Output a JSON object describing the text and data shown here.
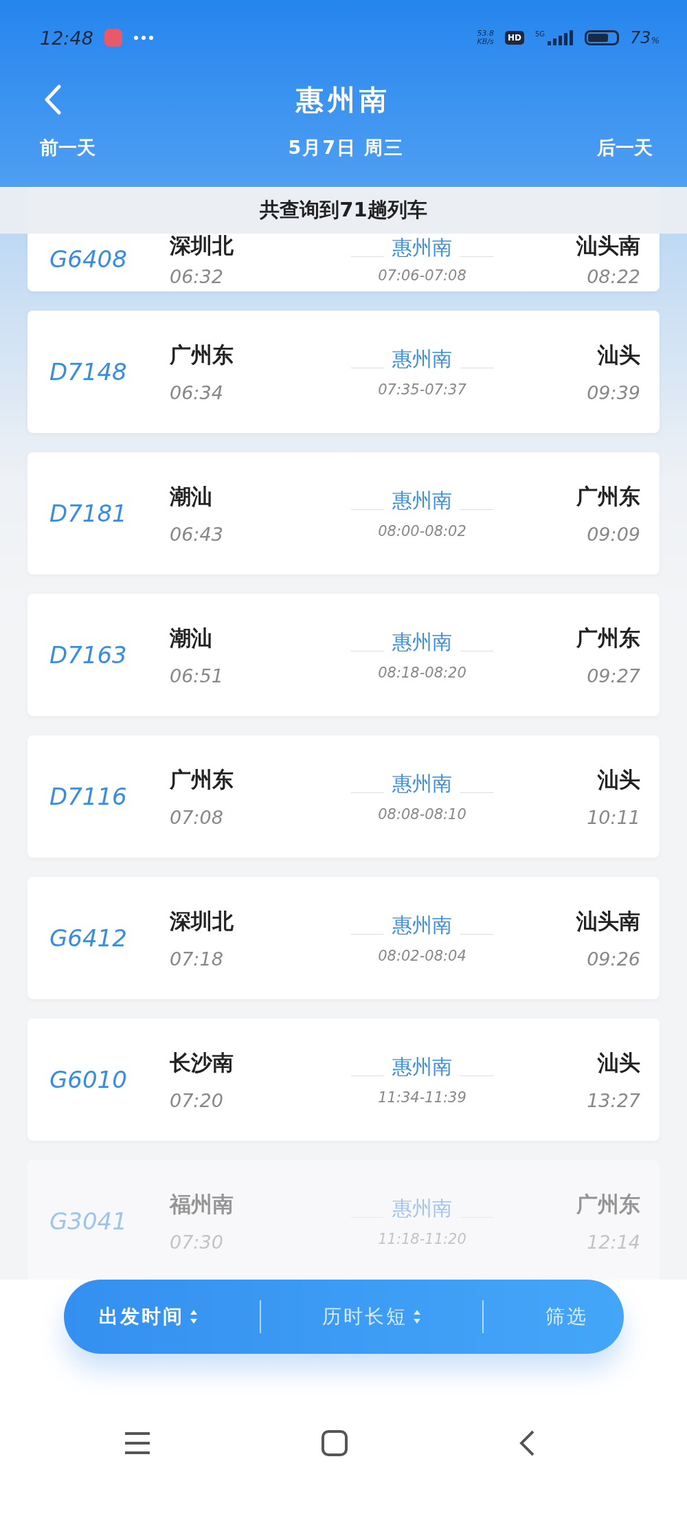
{
  "status_bar": {
    "time": "12:48",
    "speed_value": "53.8",
    "speed_unit": "KB/s",
    "hd": "HD",
    "network": "5G",
    "battery_text": "73",
    "battery_unit": "%"
  },
  "header": {
    "title": "惠州南",
    "prev_day": "前一天",
    "date": "5月7日 周三",
    "next_day": "后一天"
  },
  "result_banner": "共查询到71趟列车",
  "trains": [
    {
      "number": "G6408",
      "from": "深圳北",
      "depart": "06:32",
      "station": "惠州南",
      "stop": "07:06-07:08",
      "to": "汕头南",
      "arrive": "08:22",
      "faded": false
    },
    {
      "number": "D7148",
      "from": "广州东",
      "depart": "06:34",
      "station": "惠州南",
      "stop": "07:35-07:37",
      "to": "汕头",
      "arrive": "09:39",
      "faded": false
    },
    {
      "number": "D7181",
      "from": "潮汕",
      "depart": "06:43",
      "station": "惠州南",
      "stop": "08:00-08:02",
      "to": "广州东",
      "arrive": "09:09",
      "faded": false
    },
    {
      "number": "D7163",
      "from": "潮汕",
      "depart": "06:51",
      "station": "惠州南",
      "stop": "08:18-08:20",
      "to": "广州东",
      "arrive": "09:27",
      "faded": false
    },
    {
      "number": "D7116",
      "from": "广州东",
      "depart": "07:08",
      "station": "惠州南",
      "stop": "08:08-08:10",
      "to": "汕头",
      "arrive": "10:11",
      "faded": false
    },
    {
      "number": "G6412",
      "from": "深圳北",
      "depart": "07:18",
      "station": "惠州南",
      "stop": "08:02-08:04",
      "to": "汕头南",
      "arrive": "09:26",
      "faded": false
    },
    {
      "number": "G6010",
      "from": "长沙南",
      "depart": "07:20",
      "station": "惠州南",
      "stop": "11:34-11:39",
      "to": "汕头",
      "arrive": "13:27",
      "faded": false
    },
    {
      "number": "G3041",
      "from": "福州南",
      "depart": "07:30",
      "station": "惠州南",
      "stop": "11:18-11:20",
      "to": "广州东",
      "arrive": "12:14",
      "faded": true
    }
  ],
  "sort_bar": [
    {
      "label": "出发时间",
      "kind": "sort",
      "selected": true
    },
    {
      "label": "历时长短",
      "kind": "sort",
      "selected": false
    },
    {
      "label": "筛选",
      "kind": "filter",
      "selected": false
    }
  ]
}
